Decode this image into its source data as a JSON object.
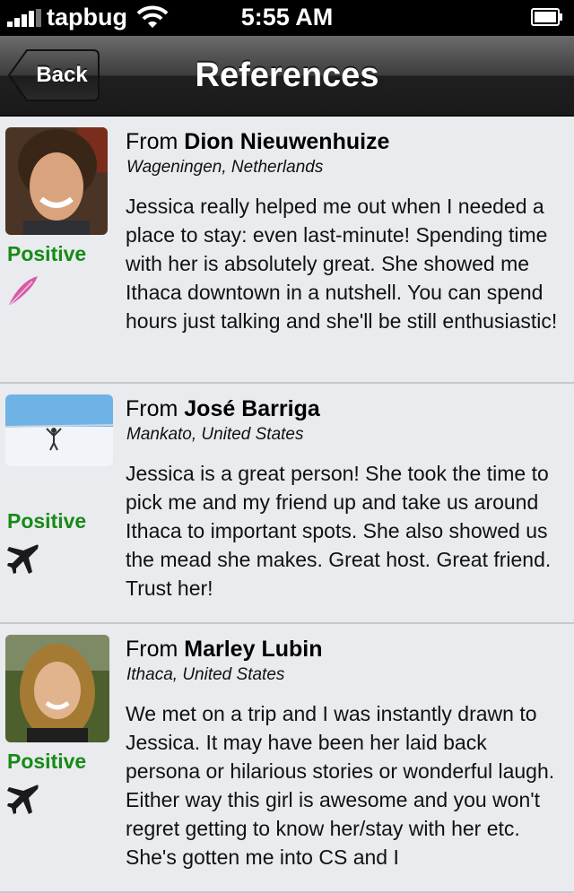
{
  "status_bar": {
    "carrier": "tapbug",
    "time": "5:55 AM"
  },
  "nav": {
    "back_label": "Back",
    "title": "References"
  },
  "references": [
    {
      "from_prefix": "From",
      "name": "Dion Nieuwenhuize",
      "location": "Wageningen, Netherlands",
      "rating": "Positive",
      "type_icon": "feather-icon",
      "text": "Jessica really helped me out when I needed a place to stay: even last-minute! Spending time with her is absolutely great. She showed me Ithaca downtown in a nutshell. You can spend hours just talking and she'll be still enthusiastic!"
    },
    {
      "from_prefix": "From",
      "name": "José Barriga",
      "location": "Mankato, United States",
      "rating": "Positive",
      "type_icon": "airplane-icon",
      "text": "Jessica is a great person! She took the time to pick me and my friend up and take us around Ithaca to important spots. She also showed us the mead she makes. Great host. Great friend. Trust her!"
    },
    {
      "from_prefix": "From",
      "name": "Marley Lubin",
      "location": "Ithaca, United States",
      "rating": "Positive",
      "type_icon": "airplane-icon",
      "text": "We met on a trip and I was instantly drawn to Jessica. It may have been her laid back persona or hilarious stories or wonderful laugh. Either way this girl is awesome and you won't regret getting to know her/stay with her etc. She's gotten me into CS and I"
    }
  ],
  "colors": {
    "positive": "#178a18",
    "background": "#e9ebee"
  }
}
